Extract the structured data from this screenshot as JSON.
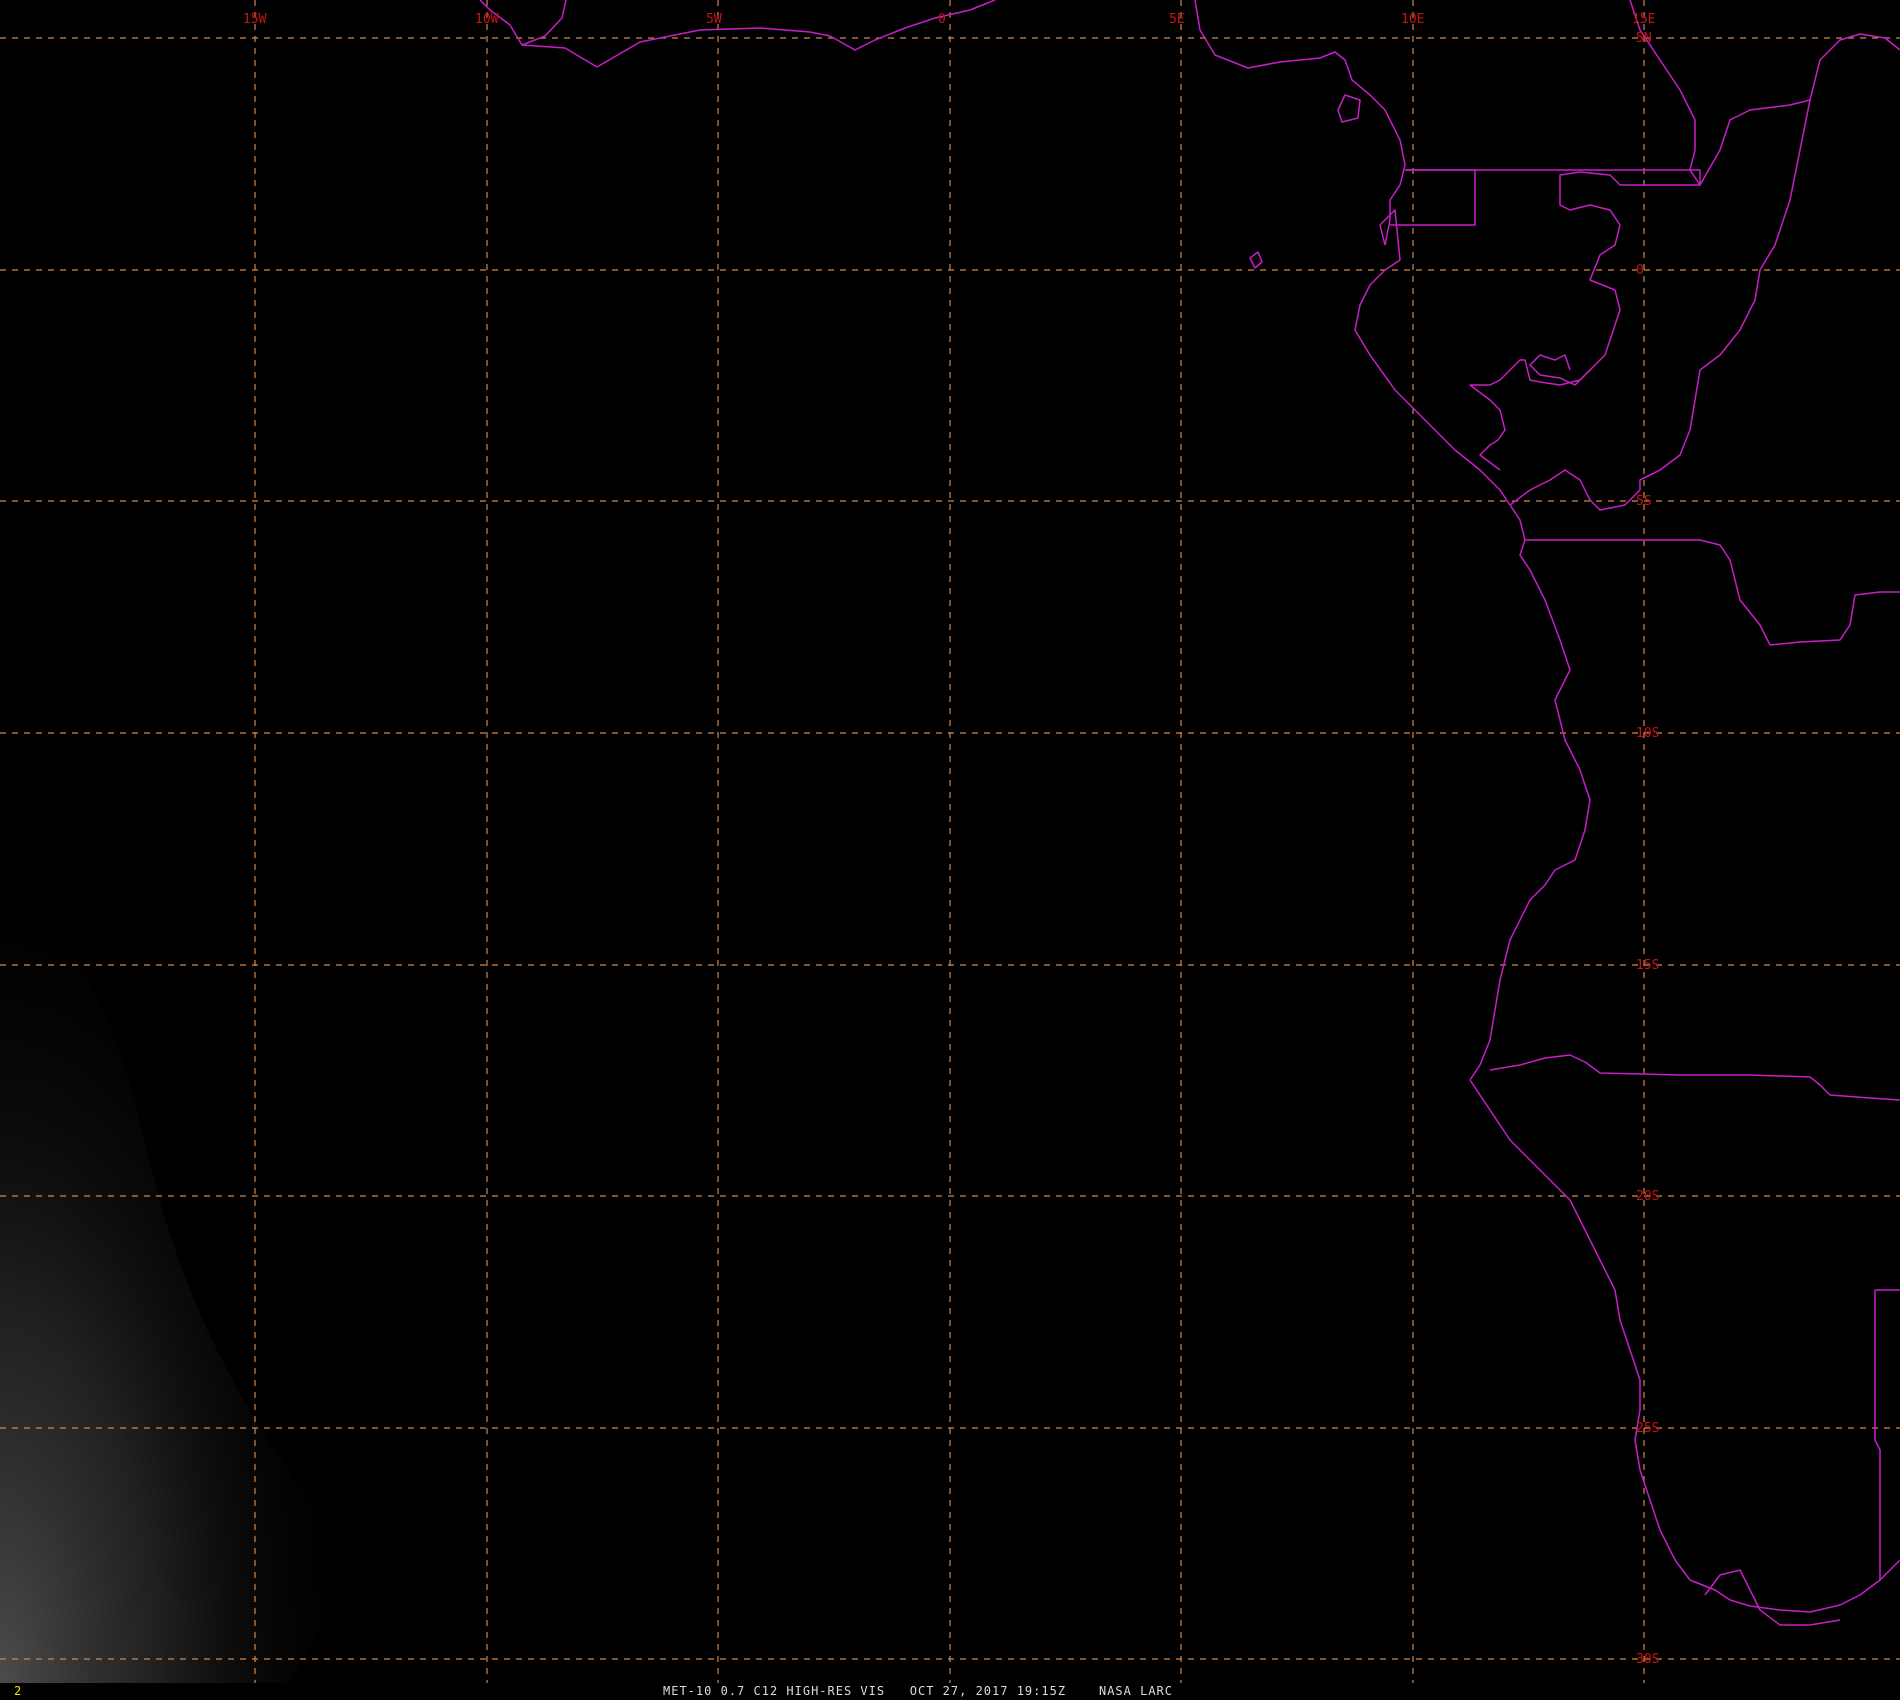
{
  "map": {
    "longitude_labels": [
      "15W",
      "10W",
      "5W",
      "0",
      "5E",
      "10E",
      "15E"
    ],
    "latitude_labels": [
      "5N",
      "0",
      "5S",
      "10S",
      "15S",
      "20S",
      "25S",
      "30S"
    ],
    "colors": {
      "grid": "#d2874a",
      "coastline": "#c81ec8",
      "labels": "#c81414",
      "background": "#000000"
    }
  },
  "footer": {
    "frame_number": "2",
    "satellite": "MET-10",
    "channel": "0.7 C12 HIGH-RES VIS",
    "timestamp": "OCT 27, 2017 19:15Z",
    "source": "NASA LARC"
  }
}
